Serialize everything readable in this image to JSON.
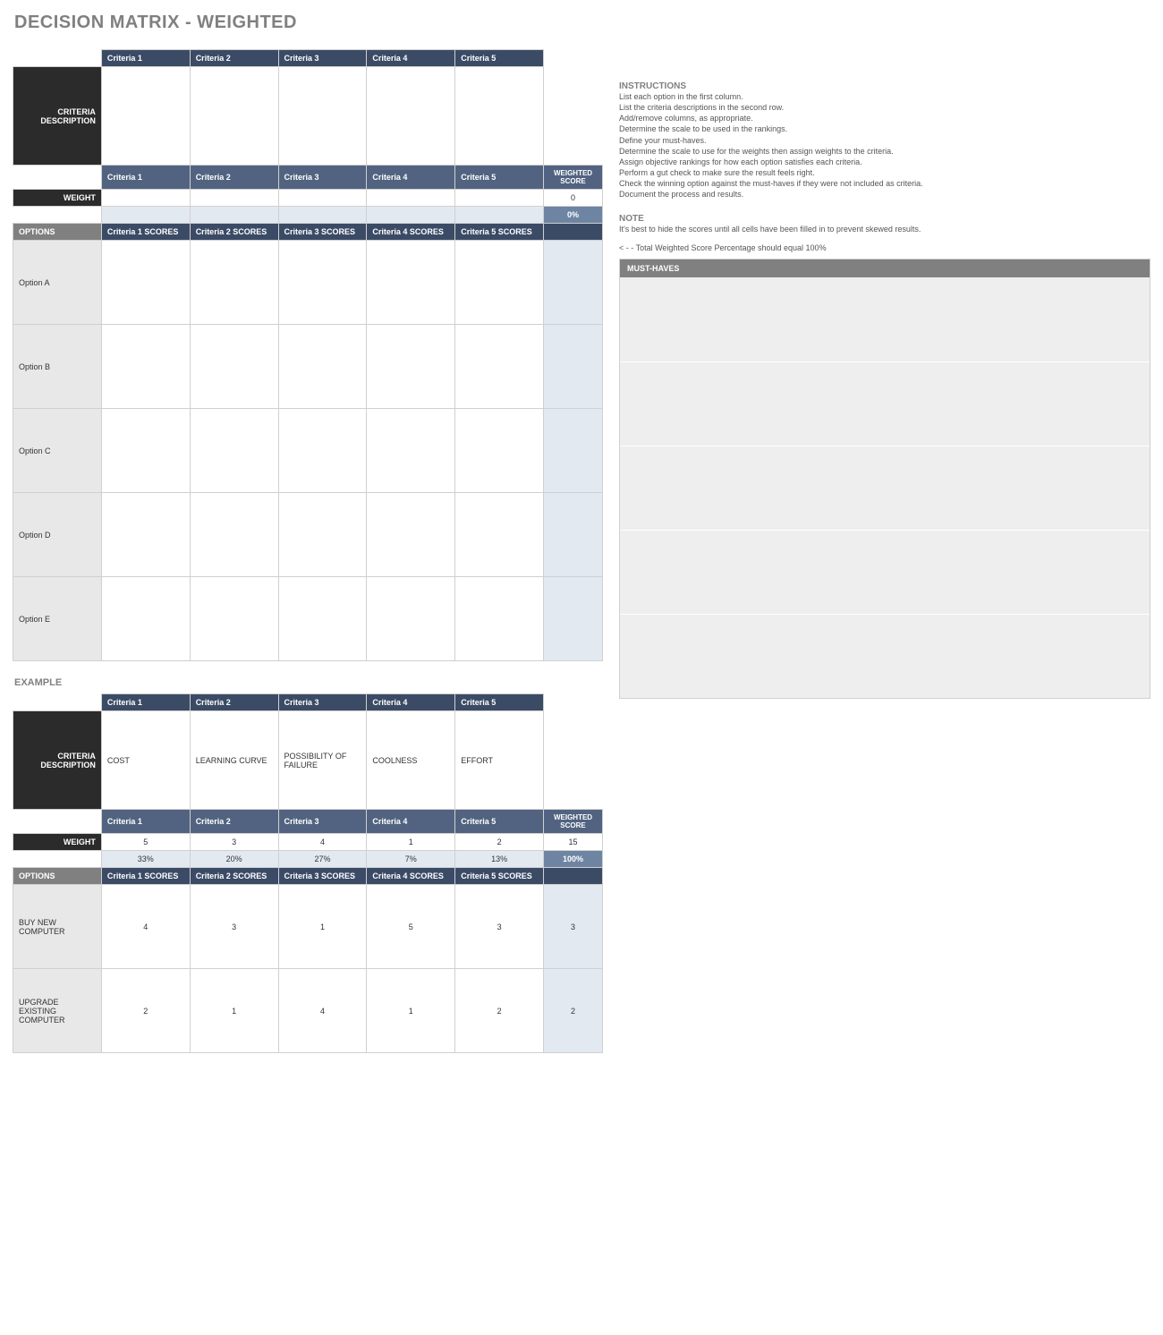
{
  "title": "DECISION MATRIX - WEIGHTED",
  "labels": {
    "criteria_description": "CRITERIA DESCRIPTION",
    "weight": "WEIGHT",
    "options": "OPTIONS",
    "weighted_score": "WEIGHTED SCORE",
    "example": "EXAMPLE"
  },
  "criteria_headers": [
    "Criteria 1",
    "Criteria 2",
    "Criteria 3",
    "Criteria 4",
    "Criteria 5"
  ],
  "score_headers": [
    "Criteria 1 SCORES",
    "Criteria 2 SCORES",
    "Criteria 3 SCORES",
    "Criteria 4 SCORES",
    "Criteria 5 SCORES"
  ],
  "main": {
    "descriptions": [
      "",
      "",
      "",
      "",
      ""
    ],
    "weights": [
      "",
      "",
      "",
      "",
      ""
    ],
    "weight_total": "0",
    "weight_pcts": [
      "",
      "",
      "",
      "",
      ""
    ],
    "weight_pct_total": "0%",
    "options": [
      {
        "label": "Option A",
        "scores": [
          "",
          "",
          "",
          "",
          ""
        ],
        "ws": ""
      },
      {
        "label": "Option B",
        "scores": [
          "",
          "",
          "",
          "",
          ""
        ],
        "ws": ""
      },
      {
        "label": "Option C",
        "scores": [
          "",
          "",
          "",
          "",
          ""
        ],
        "ws": ""
      },
      {
        "label": "Option D",
        "scores": [
          "",
          "",
          "",
          "",
          ""
        ],
        "ws": ""
      },
      {
        "label": "Option E",
        "scores": [
          "",
          "",
          "",
          "",
          ""
        ],
        "ws": ""
      }
    ]
  },
  "instructions": {
    "title": "INSTRUCTIONS",
    "lines": [
      "List each option in the first column.",
      "List the criteria descriptions in the second row.",
      "Add/remove columns, as appropriate.",
      "Determine the scale to be used in the rankings.",
      "Define your must-haves.",
      "Determine the scale to use for the weights then assign weights to the criteria.",
      "Assign objective rankings for how each option satisfies each criteria.",
      "Perform a gut check to make sure the result feels right.",
      "Check the winning option against the must-haves if they were not included as criteria.",
      "Document the process and results."
    ]
  },
  "note": {
    "title": "NOTE",
    "text": "It's best to hide the scores until all cells have been filled in to prevent skewed results.",
    "arrow": "< - - Total Weighted Score Percentage should equal 100%"
  },
  "must_haves": {
    "title": "MUST-HAVES",
    "rows": [
      "",
      "",
      "",
      "",
      ""
    ]
  },
  "example": {
    "descriptions": [
      "COST",
      "LEARNING CURVE",
      "POSSIBILITY OF FAILURE",
      "COOLNESS",
      "EFFORT"
    ],
    "weights": [
      "5",
      "3",
      "4",
      "1",
      "2"
    ],
    "weight_total": "15",
    "weight_pcts": [
      "33%",
      "20%",
      "27%",
      "7%",
      "13%"
    ],
    "weight_pct_total": "100%",
    "options": [
      {
        "label": "BUY NEW COMPUTER",
        "scores": [
          "4",
          "3",
          "1",
          "5",
          "3"
        ],
        "ws": "3"
      },
      {
        "label": "UPGRADE EXISTING COMPUTER",
        "scores": [
          "2",
          "1",
          "4",
          "1",
          "2"
        ],
        "ws": "2"
      }
    ]
  }
}
